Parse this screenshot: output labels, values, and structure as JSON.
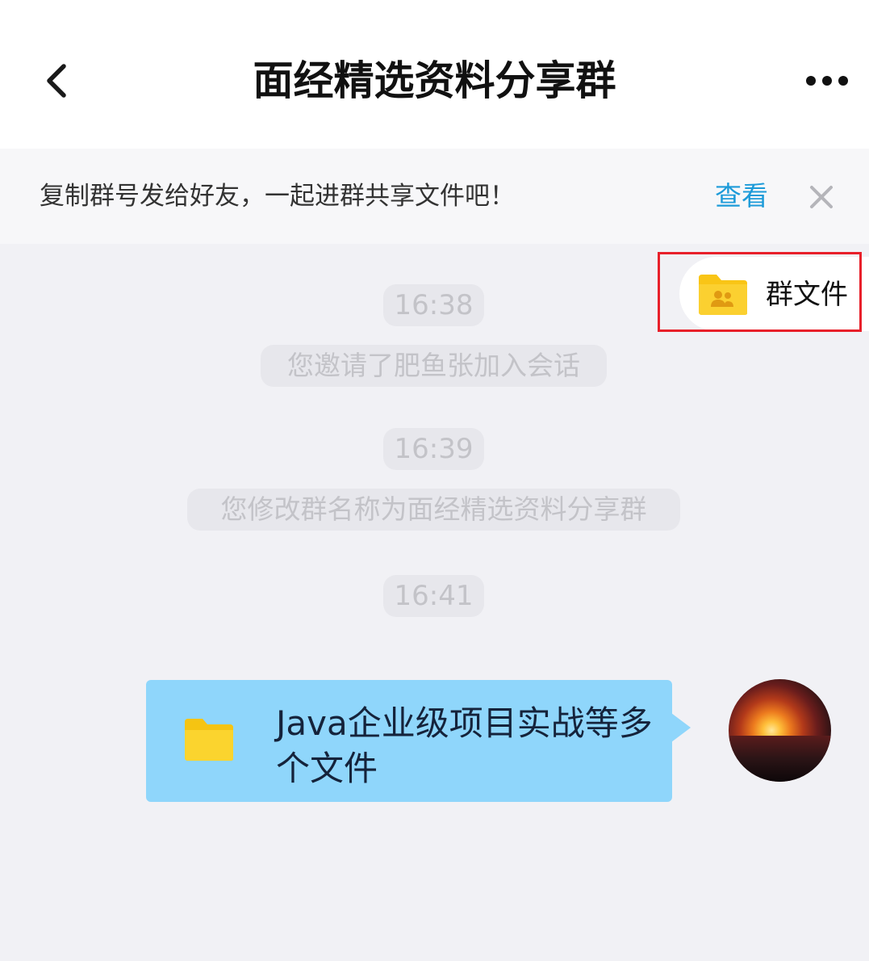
{
  "header": {
    "back_icon": "chevron-left-icon",
    "title": "面经精选资料分享群",
    "more_icon": "more-horizontal-icon"
  },
  "notice": {
    "text": "复制群号发给好友，一起进群共享文件吧！",
    "link_label": "查看",
    "link_color": "#1d9bd9",
    "close_icon": "close-icon"
  },
  "group_files": {
    "label": "群文件",
    "icon": "group-folder-icon",
    "highlight_color": "#e8202a"
  },
  "messages": [
    {
      "type": "time",
      "text": "16:38"
    },
    {
      "type": "system",
      "text": "您邀请了肥鱼张加入会话"
    },
    {
      "type": "time",
      "text": "16:39"
    },
    {
      "type": "system",
      "text": "您修改群名称为面经精选资料分享群"
    },
    {
      "type": "time",
      "text": "16:41"
    },
    {
      "type": "file",
      "text": "Java企业级项目实战等多个文件",
      "icon": "folder-icon",
      "bubble_color": "#8fd6fb",
      "sender_avatar": "sunset-avatar"
    }
  ]
}
